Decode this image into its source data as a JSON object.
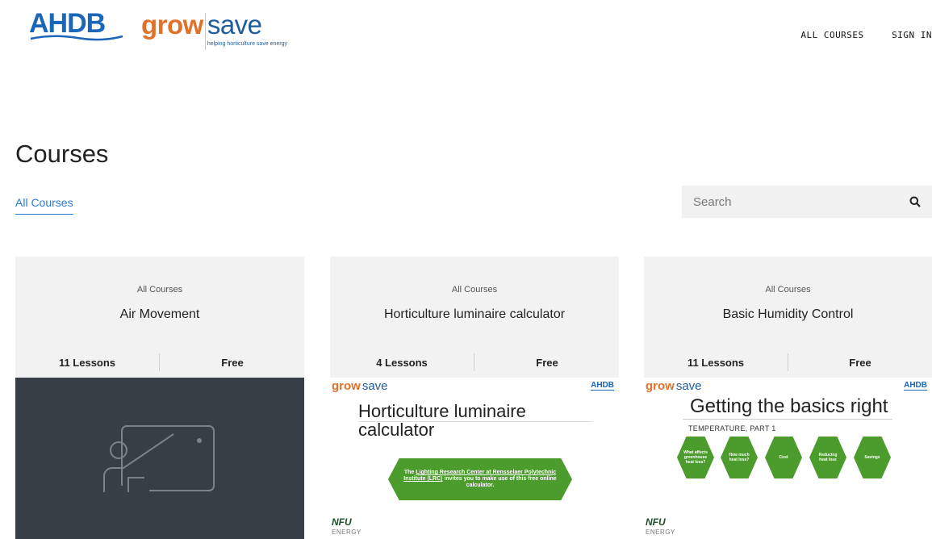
{
  "header": {
    "logo_ahdb": "AHDB",
    "logo_grow": "grow",
    "logo_save": "save",
    "logo_tagline": "helping horticulture save energy",
    "nav": [
      "ALL COURSES",
      "SIGN IN"
    ]
  },
  "page": {
    "title": "Courses",
    "filter_tab": "All Courses"
  },
  "search": {
    "placeholder": "Search",
    "value": ""
  },
  "colors": {
    "accent_blue": "#2a7ad2",
    "brand_orange": "#e0712b",
    "brand_blue": "#1a66b8",
    "slide_green": "#4c9b2d",
    "thumb_dark": "#373e46"
  },
  "cards": [
    {
      "category": "All Courses",
      "title": "Air Movement",
      "lessons": "11 Lessons",
      "price": "Free",
      "thumbnail_icon": "presentation-board-icon"
    },
    {
      "category": "All Courses",
      "title": "Horticulture luminaire calculator",
      "lessons": "4 Lessons",
      "price": "Free",
      "slide": {
        "grow": "grow",
        "save": "save",
        "ahdb": "AHDB",
        "title_line1": "Horticulture luminaire",
        "title_line2": "calculator",
        "banner_pre": "The ",
        "banner_link": "Lighting Research Center at Rensselaer Polytechnic Institute (LRC)",
        "banner_post": " invites you to make use of this free online calculator.",
        "nfu": "NFU",
        "energy": "ENERGY"
      }
    },
    {
      "category": "All Courses",
      "title": "Basic Humidity Control",
      "lessons": "11 Lessons",
      "price": "Free",
      "slide": {
        "grow": "grow",
        "save": "save",
        "ahdb": "AHDB",
        "title": "Getting the basics right",
        "subtitle": "TEMPERATURE, PART 1",
        "hexes": [
          "What affects greenhouse heat loss?",
          "How much heat loss?",
          "Cost",
          "Reducing heat loss",
          "Savings"
        ],
        "nfu": "NFU",
        "energy": "ENERGY"
      }
    }
  ]
}
